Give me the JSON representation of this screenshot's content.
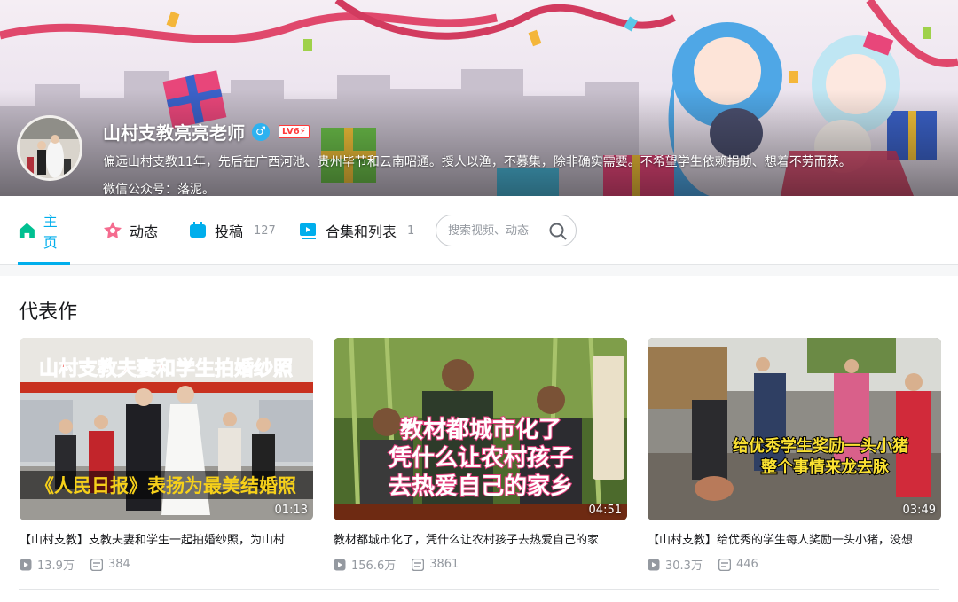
{
  "profile": {
    "name": "山村支教亮亮老师",
    "gender_symbol": "♂",
    "level": "LV6⚡",
    "bio": "偏远山村支教11年，先后在广西河池、贵州毕节和云南昭通。授人以渔，不募集，除非确实需要。不希望学生依赖捐助、想着不劳而获。",
    "wechat": "微信公众号：落泥。"
  },
  "nav": {
    "tabs": [
      {
        "label": "主页",
        "count": "",
        "icon": "home-icon",
        "active": true
      },
      {
        "label": "动态",
        "count": "",
        "icon": "dynamic-icon",
        "active": false
      },
      {
        "label": "投稿",
        "count": "127",
        "icon": "upload-icon",
        "active": false
      },
      {
        "label": "合集和列表",
        "count": "1",
        "icon": "collection-icon",
        "active": false
      }
    ],
    "search_placeholder": "搜索视频、动态"
  },
  "section": {
    "title": "代表作"
  },
  "videos": [
    {
      "overlay_top": "山村支教夫妻和学生拍婚纱照",
      "overlay_bottom": "《人民日报》表扬为最美结婚照",
      "duration": "01:13",
      "title": "【山村支教】支教夫妻和学生一起拍婚纱照，为山村",
      "views": "13.9万",
      "danmaku": "384"
    },
    {
      "overlay_top": "",
      "overlay_lines": [
        "教材都城市化了",
        "凭什么让农村孩子",
        "去热爱自己的家乡"
      ],
      "duration": "04:51",
      "title": "教材都城市化了，凭什么让农村孩子去热爱自己的家",
      "views": "156.6万",
      "danmaku": "3861"
    },
    {
      "overlay_lines": [
        "给优秀学生奖励一头小猪",
        "整个事情来龙去脉"
      ],
      "duration": "03:49",
      "title": "【山村支教】给优秀的学生每人奖励一头小猪，没想",
      "views": "30.3万",
      "danmaku": "446"
    }
  ],
  "colors": {
    "accent": "#00aeec",
    "muted": "#9499a0",
    "level_red": "#ff3b3b"
  }
}
